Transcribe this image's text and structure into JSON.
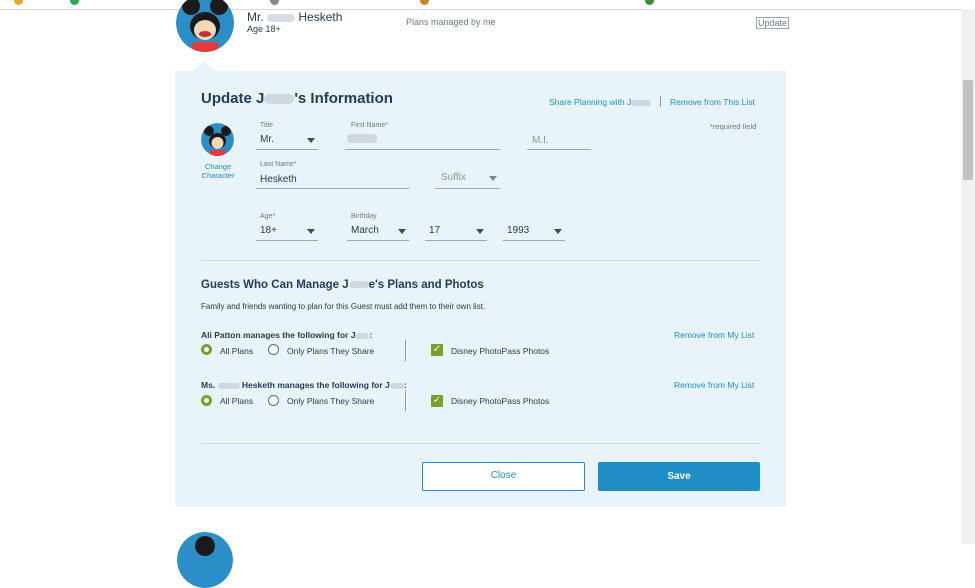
{
  "header": {
    "name_prefix": "Mr.",
    "name_last": "Hesketh",
    "age": "Age 18+",
    "plans_text": "Plans managed by me",
    "update_label": "Update"
  },
  "panel": {
    "title_left": "Update J",
    "title_right": "'s Information",
    "share_planning": "Share Planning with J",
    "remove_list": "Remove from This List",
    "required_note": "*required field",
    "change_character": [
      "Change",
      "Character"
    ],
    "fields": {
      "title": {
        "label": "Title",
        "value": "Mr."
      },
      "first_name": {
        "label": "First Name*"
      },
      "mi": {
        "placeholder": "M.I."
      },
      "last_name": {
        "label": "Last Name*",
        "value": "Hesketh"
      },
      "suffix": {
        "placeholder": "Suffix"
      },
      "age": {
        "label": "Age*",
        "value": "18+"
      },
      "birthday": {
        "label": "Birthday",
        "month": "March",
        "day": "17",
        "year": "1993"
      }
    }
  },
  "guests": {
    "heading_left": "Guests Who Can Manage J",
    "heading_right": "e's Plans and Photos",
    "note": "Family and friends wanting to plan for this Guest must add them to their own list.",
    "managers": [
      {
        "label_left": "Ali Patton manages the following for J",
        "label_right": ":",
        "remove": "Remove from My List",
        "opt_all": "All Plans",
        "opt_share": "Only Plans They Share",
        "photopass": "Disney PhotoPass Photos"
      },
      {
        "label_left": "Ms.",
        "label_mid": "Hesketh manages the following for J",
        "label_right": ":",
        "remove": "Remove from My List",
        "opt_all": "All Plans",
        "opt_share": "Only Plans They Share",
        "photopass": "Disney PhotoPass Photos"
      }
    ]
  },
  "buttons": {
    "close": "Close",
    "save": "Save"
  },
  "colors": {
    "accent": "#1f8ec6",
    "panel_bg": "#e8f4fa",
    "check_green": "#77a12a",
    "text": "#253b56"
  }
}
